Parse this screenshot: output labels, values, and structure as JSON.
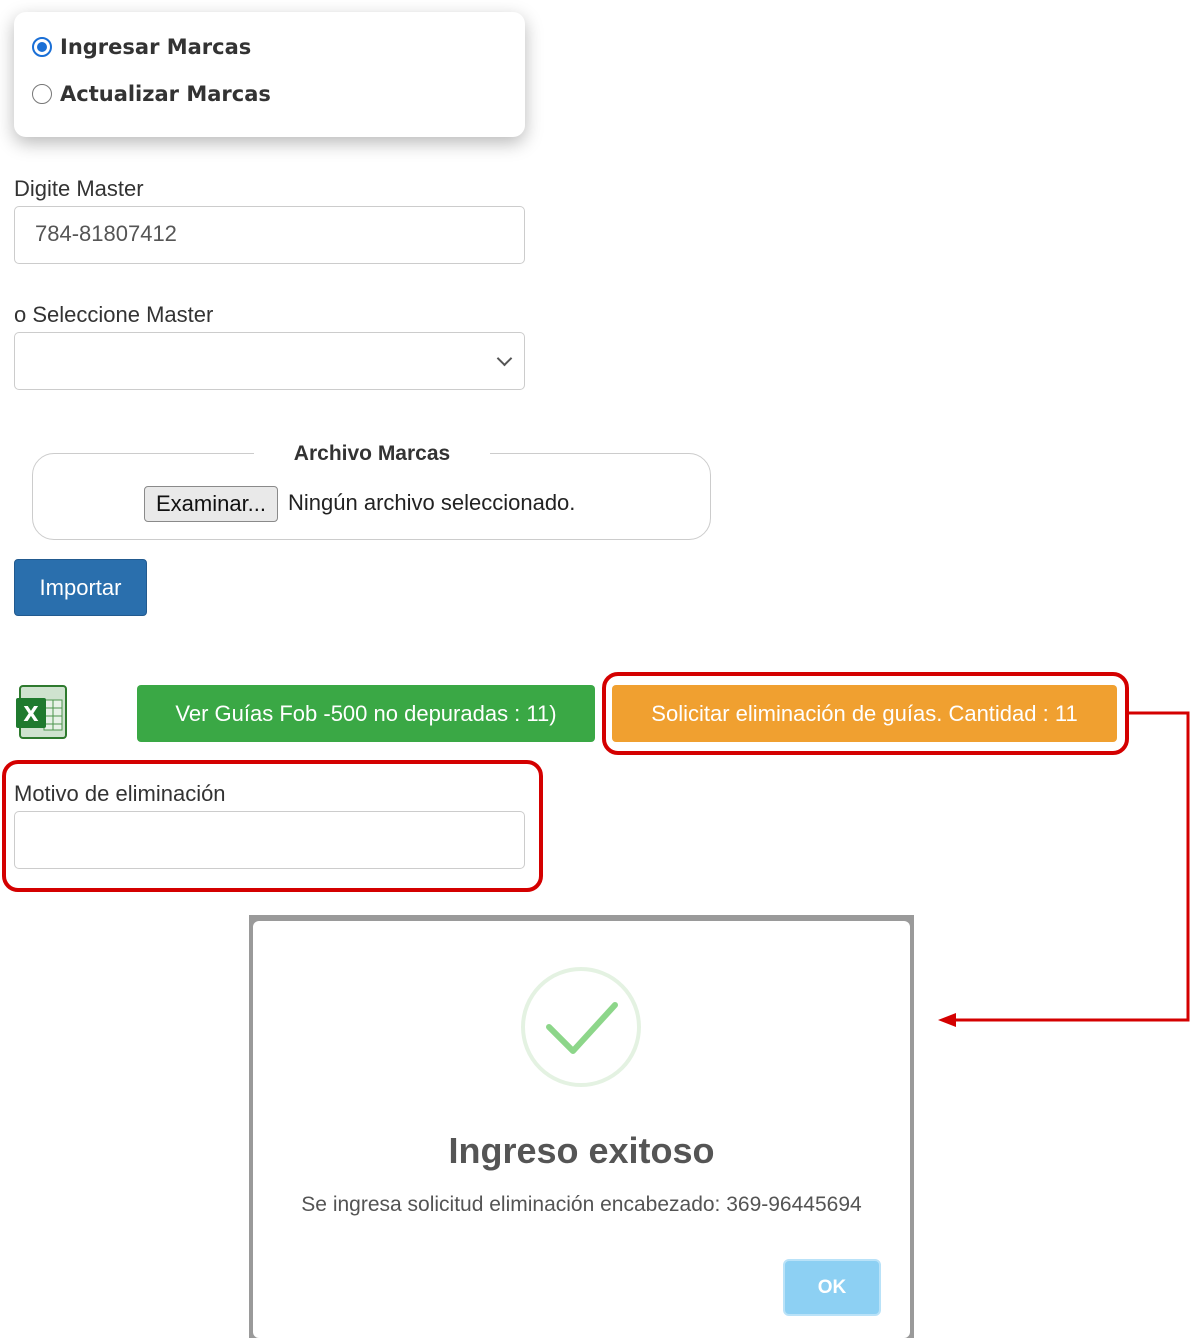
{
  "mode_options": [
    {
      "label": "Ingresar Marcas",
      "selected": true
    },
    {
      "label": "Actualizar Marcas",
      "selected": false
    }
  ],
  "master_input": {
    "label": "Digite Master",
    "value": "784-81807412"
  },
  "master_select": {
    "label": "o Seleccione Master",
    "selected": ""
  },
  "file_upload": {
    "legend": "Archivo Marcas",
    "browse_label": "Examinar...",
    "status": "Ningún archivo seleccionado."
  },
  "import_button": "Importar",
  "excel_icon": "excel-icon",
  "view_guides_button": "Ver Guías Fob -500 no depuradas : 11)",
  "request_delete_button": "Solicitar eliminación de guías. Cantidad : 11",
  "delete_reason": {
    "label": "Motivo de eliminación",
    "value": ""
  },
  "dialog": {
    "icon": "success-check-icon",
    "title": "Ingreso exitoso",
    "message": "Se ingresa solicitud eliminación encabezado: 369-96445694",
    "ok_label": "OK"
  },
  "colors": {
    "primary": "#2a6fad",
    "success": "#3aa845",
    "warning": "#f0a030",
    "highlight": "#d40000",
    "check": "#8dd68a",
    "ok_button": "#8dd0f3"
  }
}
